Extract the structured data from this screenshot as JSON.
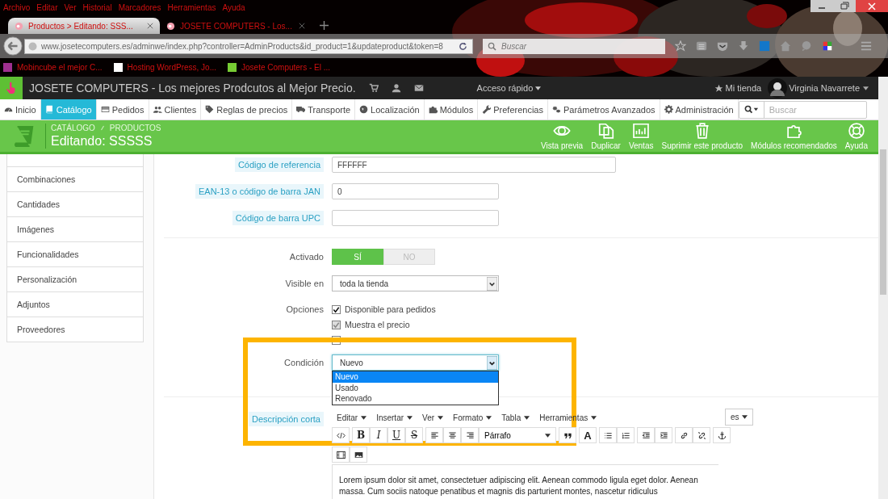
{
  "browser": {
    "menu": [
      "Archivo",
      "Editar",
      "Ver",
      "Historial",
      "Marcadores",
      "Herramientas",
      "Ayuda"
    ],
    "tabs": [
      {
        "title": "Productos > Editando: SSS...",
        "selected": true
      },
      {
        "title": "JOSETE COMPUTERS - Los...",
        "selected": false
      }
    ],
    "url": "www.josetecomputers.es/adminwe/index.php?controller=AdminProducts&id_product=1&updateproduct&token=8",
    "search_placeholder": "Buscar",
    "bookmarks": [
      "Mobincube el mejor C...",
      "Hosting WordPress, Jo...",
      "Josete Computers - El ..."
    ]
  },
  "header": {
    "shop_title": "JOSETE COMPUTERS - Los mejores Prodcutos al Mejor Precio.",
    "quick_access": "Acceso rápido",
    "my_shop": "Mi tienda",
    "user": "Virginia Navarrete"
  },
  "nav": [
    {
      "label": "Inicio",
      "selected": false
    },
    {
      "label": "Catálogo",
      "selected": true
    },
    {
      "label": "Pedidos",
      "selected": false
    },
    {
      "label": "Clientes",
      "selected": false
    },
    {
      "label": "Reglas de precios",
      "selected": false
    },
    {
      "label": "Transporte",
      "selected": false
    },
    {
      "label": "Localización",
      "selected": false
    },
    {
      "label": "Módulos",
      "selected": false
    },
    {
      "label": "Preferencias",
      "selected": false
    },
    {
      "label": "Parámetros Avanzados",
      "selected": false
    },
    {
      "label": "Administración",
      "selected": false
    }
  ],
  "nav_search_placeholder": "Buscar",
  "toolbar": {
    "breadcrumb": [
      "CATÁLOGO",
      "PRODUCTOS"
    ],
    "title": "Editando: SSSSS",
    "actions": [
      "Vista previa",
      "Duplicar",
      "Ventas",
      "Suprimir este producto",
      "Módulos recomendados",
      "Ayuda"
    ]
  },
  "sidebar": [
    "Combinaciones",
    "Cantidades",
    "Imágenes",
    "Funcionalidades",
    "Personalización",
    "Adjuntos",
    "Proveedores"
  ],
  "form": {
    "reference": {
      "label": "Código de referencia",
      "value": "FFFFFF"
    },
    "ean": {
      "label": "EAN-13 o código de barra JAN",
      "value": "0"
    },
    "upc": {
      "label": "Código de barra UPC"
    },
    "active": {
      "label": "Activado",
      "options": [
        {
          "label": "SÍ",
          "selected": true
        },
        {
          "label": "NO",
          "selected": false
        }
      ]
    },
    "visibility": {
      "label": "Visible en",
      "value": "toda la tienda"
    },
    "options": {
      "label": "Opciones",
      "items": [
        {
          "label": "Disponible para pedidos",
          "checked": true,
          "disabled": false
        },
        {
          "label": "Muestra el precio",
          "checked": true,
          "disabled": true
        },
        {
          "checked": false,
          "disabled": false
        }
      ]
    },
    "condition": {
      "label": "Condición",
      "value": "Nuevo",
      "expanded": true,
      "choices": [
        {
          "label": "Nuevo",
          "selected": true
        },
        {
          "label": "Usado",
          "selected": false
        },
        {
          "label": "Renovado",
          "selected": false
        }
      ]
    },
    "short_description": {
      "label": "Descripción corta",
      "menus": [
        "Editar",
        "Insertar",
        "Ver",
        "Formato",
        "Tabla",
        "Herramientas"
      ],
      "text_buttons": [
        {
          "label": "B",
          "kind": "bold"
        },
        {
          "label": "I",
          "kind": "italic"
        },
        {
          "label": "U",
          "kind": "underline"
        },
        {
          "label": "S",
          "kind": "strike"
        }
      ],
      "block_format": "Párrafo",
      "color_button": "A",
      "language": "es",
      "text": "Lorem ipsum dolor sit amet, consectetuer adipiscing elit. Aenean commodo ligula eget dolor. Aenean massa. Cum sociis natoque penatibus et magnis dis parturient montes, nascetur ridiculus"
    }
  }
}
